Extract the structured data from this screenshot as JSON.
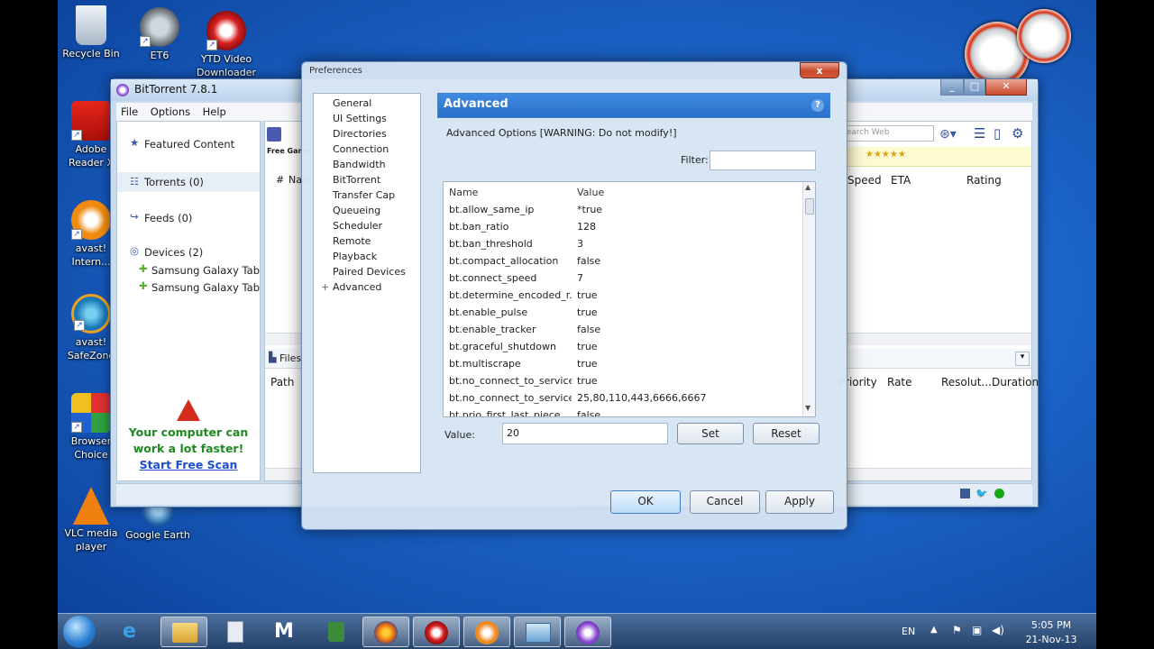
{
  "desktop": {
    "icons": [
      {
        "label": "Recycle Bin",
        "icon": "recycle-bin-icon"
      },
      {
        "label": "ET6",
        "icon": "et6-icon"
      },
      {
        "label": "YTD Video Downloader",
        "icon": "ytd-downloader-icon"
      },
      {
        "label": "Adobe Reader X",
        "icon": "adobe-reader-icon"
      },
      {
        "label": "avast! Intern...",
        "icon": "avast-icon"
      },
      {
        "label": "avast! SafeZone",
        "icon": "avast-safezone-icon"
      },
      {
        "label": "Browser Choice",
        "icon": "browser-choice-icon"
      },
      {
        "label": "VLC media player",
        "icon": "vlc-icon"
      },
      {
        "label": "Google Earth",
        "icon": "google-earth-icon"
      }
    ]
  },
  "bittorrent": {
    "title": "BitTorrent 7.8.1",
    "menu": [
      "File",
      "Options",
      "Help"
    ],
    "sidebar": {
      "featured": "Featured Content",
      "torrents": "Torrents (0)",
      "feeds": "Feeds (0)",
      "devices": "Devices (2)",
      "device1": "Samsung Galaxy Tab",
      "device2": "Samsung Galaxy Tab",
      "ad_line1": "Your computer can",
      "ad_line2": "work a lot faster!",
      "ad_link": "Start Free Scan"
    },
    "search_placeholder": "Search Web",
    "free_games": "Free Game",
    "columns": [
      "#",
      "Name",
      "Speed",
      "ETA",
      "Rating"
    ],
    "files_tab": "Files",
    "file_columns": [
      "Path",
      "Priority",
      "Rate",
      "Resolut...",
      "Duration"
    ]
  },
  "preferences": {
    "title": "Preferences",
    "close": "x",
    "tree": [
      "General",
      "UI Settings",
      "Directories",
      "Connection",
      "Bandwidth",
      "BitTorrent",
      "Transfer Cap",
      "Queueing",
      "Scheduler",
      "Remote",
      "Playback",
      "Paired Devices",
      "Advanced"
    ],
    "tree_expander": "+",
    "header": "Advanced",
    "help": "?",
    "warning": "Advanced Options [WARNING: Do not modify!]",
    "filter_label": "Filter:",
    "grid": {
      "col_name": "Name",
      "col_value": "Value",
      "rows": [
        {
          "name": "bt.allow_same_ip",
          "value": "*true"
        },
        {
          "name": "bt.ban_ratio",
          "value": "128"
        },
        {
          "name": "bt.ban_threshold",
          "value": "3"
        },
        {
          "name": "bt.compact_allocation",
          "value": "false"
        },
        {
          "name": "bt.connect_speed",
          "value": "7"
        },
        {
          "name": "bt.determine_encoded_r...",
          "value": "true"
        },
        {
          "name": "bt.enable_pulse",
          "value": "true"
        },
        {
          "name": "bt.enable_tracker",
          "value": "false"
        },
        {
          "name": "bt.graceful_shutdown",
          "value": "true"
        },
        {
          "name": "bt.multiscrape",
          "value": "true"
        },
        {
          "name": "bt.no_connect_to_services",
          "value": "true"
        },
        {
          "name": "bt.no_connect_to_service...",
          "value": "25,80,110,443,6666,6667"
        },
        {
          "name": "bt.prio_first_last_piece",
          "value": "false"
        }
      ]
    },
    "value_label": "Value:",
    "value": "20",
    "set_label": "Set",
    "reset_label": "Reset",
    "ok_label": "OK",
    "cancel_label": "Cancel",
    "apply_label": "Apply"
  },
  "taskbar": {
    "language": "EN",
    "time": "5:05 PM",
    "date": "21-Nov-13"
  }
}
